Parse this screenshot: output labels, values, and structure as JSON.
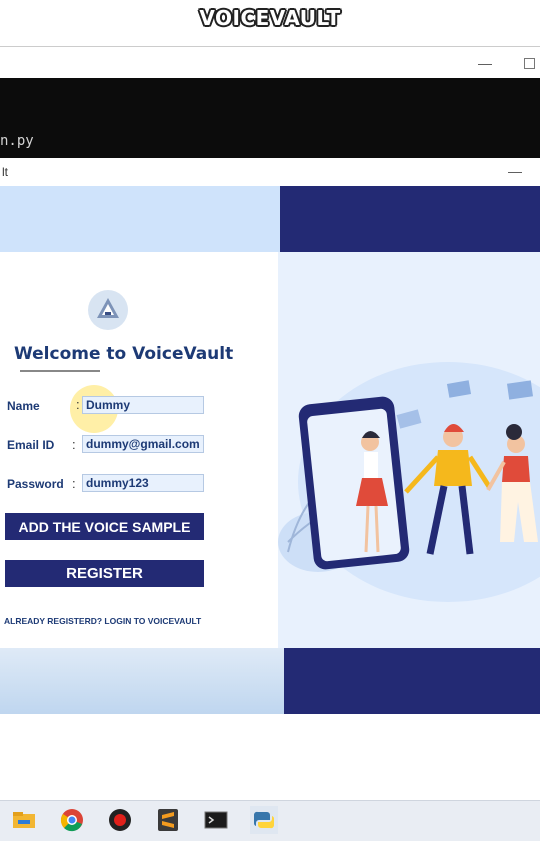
{
  "banner": {
    "title": "VOICEVAULT"
  },
  "terminal": {
    "command_fragment": "n.py"
  },
  "app_window": {
    "title_fragment": "lt"
  },
  "form": {
    "welcome_text": "Welcome to VoiceVault",
    "fields": [
      {
        "label": "Name",
        "value": "Dummy"
      },
      {
        "label": "Email ID",
        "value": "dummy@gmail.com"
      },
      {
        "label": "Password",
        "value": "dummy123"
      }
    ],
    "add_voice_label": "ADD THE VOICE SAMPLE",
    "register_label": "REGISTER",
    "login_link": "ALREADY REGISTERD? LOGIN TO VOICEVAULT"
  },
  "colors": {
    "navy": "#232a74",
    "light_blue": "#cfe3fb",
    "text_blue": "#1d3a75"
  },
  "taskbar": {
    "apps": [
      {
        "name": "file-explorer-icon"
      },
      {
        "name": "chrome-icon"
      },
      {
        "name": "recorder-icon"
      },
      {
        "name": "sublime-text-icon"
      },
      {
        "name": "terminal-icon"
      },
      {
        "name": "python-icon"
      }
    ]
  }
}
